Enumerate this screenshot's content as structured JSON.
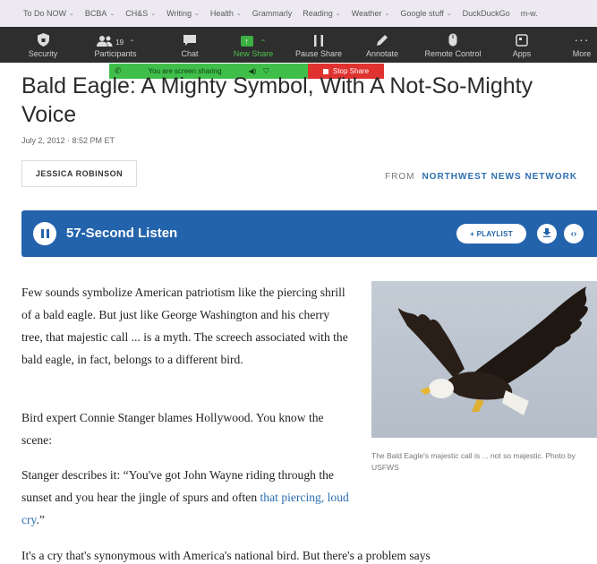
{
  "bookmarks": [
    {
      "label": "To Do NOW",
      "chevron": true
    },
    {
      "label": "BCBA",
      "chevron": true
    },
    {
      "label": "CH&S",
      "chevron": true
    },
    {
      "label": "Writing",
      "chevron": true
    },
    {
      "label": "Health",
      "chevron": true
    },
    {
      "label": "Grammarly",
      "chevron": false
    },
    {
      "label": "Reading",
      "chevron": true
    },
    {
      "label": "Weather",
      "chevron": true
    },
    {
      "label": "Google stuff",
      "chevron": true
    },
    {
      "label": "DuckDuckGo",
      "chevron": false
    },
    {
      "label": "m-w.",
      "chevron": false
    }
  ],
  "zoom_toolbar": {
    "security": "Security",
    "participants": "Participants",
    "participant_count": "19",
    "chat": "Chat",
    "new_share": "New Share",
    "pause_share": "Pause Share",
    "annotate": "Annotate",
    "remote_control": "Remote Control",
    "apps": "Apps",
    "more": "More",
    "accent_color": "#3cb043"
  },
  "share_indicator": {
    "status": "You are screen sharing",
    "stop_label": "Stop Share"
  },
  "article": {
    "headline": "Bald Eagle: A Mighty Symbol, With A Not-So-Mighty Voice",
    "date": "July 2, 2012 · 8:52 PM ET",
    "author": "JESSICA ROBINSON",
    "from_label": "FROM",
    "source": "NORTHWEST NEWS NETWORK"
  },
  "audio": {
    "title": "57-Second Listen",
    "playlist_label": "+ PLAYLIST",
    "bar_color": "#2363ac"
  },
  "body": {
    "p1": "Few sounds symbolize American patriotism like the piercing shrill of a bald eagle. But just like George Washington and his cherry tree, that majestic call ... is a myth. The screech associated with the bald eagle, in fact, belongs to a different bird.",
    "p2": "Bird expert Connie Stanger blames Hollywood. You know the scene:",
    "p3_text": "Stanger describes it: “You've got John Wayne riding through the sunset and you hear the jingle of spurs and often ",
    "p3_link": "that piercing, loud cry",
    "p3_end": ".”",
    "p4": "It's a cry that's synonymous with America's national bird. But there's a problem says"
  },
  "photo": {
    "caption": "The Bald Eagle's majestic call is ... not so majestic. Photo by USFWS"
  }
}
